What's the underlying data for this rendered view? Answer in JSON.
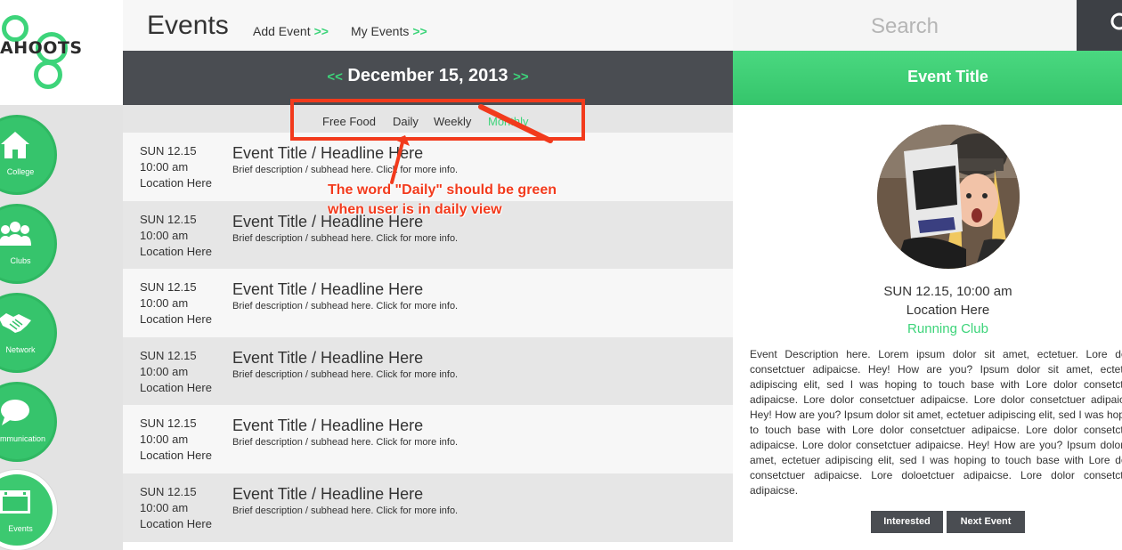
{
  "logo": {
    "text": "AHOOTS"
  },
  "nav": {
    "items": [
      {
        "label": "College",
        "icon": "house-icon"
      },
      {
        "label": "Clubs",
        "icon": "people-icon"
      },
      {
        "label": "Network",
        "icon": "handshake-icon"
      },
      {
        "label": "ommunication",
        "icon": "speech-bubble-icon"
      },
      {
        "label": "Events",
        "icon": "calendar-icon",
        "active": true
      }
    ]
  },
  "header": {
    "title": "Events",
    "links": [
      {
        "label": "Add Event",
        "arrows": ">>"
      },
      {
        "label": "My Events",
        "arrows": ">>"
      }
    ]
  },
  "date_bar": {
    "prev": "<<",
    "date": "December 15, 2013",
    "next": ">>"
  },
  "filters": {
    "items": [
      {
        "label": "Free Food",
        "active": false
      },
      {
        "label": "Daily",
        "active": false
      },
      {
        "label": "Weekly",
        "active": false
      },
      {
        "label": "Monthly",
        "active": true
      }
    ]
  },
  "events": [
    {
      "day": "SUN 12.15",
      "time": "10:00 am",
      "location": "Location Here",
      "title": "Event Title / Headline Here",
      "description": "Brief description / subhead here. Click for more info."
    },
    {
      "day": "SUN 12.15",
      "time": "10:00 am",
      "location": "Location Here",
      "title": "Event Title / Headline Here",
      "description": "Brief description / subhead here. Click for more info."
    },
    {
      "day": "SUN 12.15",
      "time": "10:00 am",
      "location": "Location Here",
      "title": "Event Title / Headline Here",
      "description": "Brief description / subhead here. Click for more info."
    },
    {
      "day": "SUN 12.15",
      "time": "10:00 am",
      "location": "Location Here",
      "title": "Event Title / Headline Here",
      "description": "Brief description / subhead here. Click for more info."
    },
    {
      "day": "SUN 12.15",
      "time": "10:00 am",
      "location": "Location Here",
      "title": "Event Title / Headline Here",
      "description": "Brief description / subhead here. Click for more info."
    },
    {
      "day": "SUN 12.15",
      "time": "10:00 am",
      "location": "Location Here",
      "title": "Event Title / Headline Here",
      "description": "Brief description / subhead here. Click for more info."
    }
  ],
  "annotation": {
    "line1": "The word \"Daily\" should be green",
    "line2": "when user is in daily view"
  },
  "search": {
    "placeholder": "Search"
  },
  "detail": {
    "header": "Event Title",
    "datetime": "SUN 12.15, 10:00 am",
    "location": "Location Here",
    "club": "Running Club",
    "description": "Event Description here. Lorem ipsum dolor sit amet, ectetuer. Lore dolor consetctuer adipaicse. Hey! How are you? Ipsum dolor sit amet, ectetuer adipiscing elit, sed I was hoping to touch base with Lore dolor consetctuer adipaicse. Lore dolor consetctuer adipaicse. Lore dolor consetctuer adipaicse. Hey! How are you? Ipsum dolor sit amet, ectetuer adipiscing elit, sed I was hoping to touch base with Lore dolor consetctuer adipaicse. Lore dolor consetctuer adipaicse. Lore dolor consetctuer adipaicse. Hey! How are you? Ipsum dolor sit amet, ectetuer adipiscing elit, sed I was hoping to touch base with Lore dolor consetctuer adipaicse. Lore doloetctuer adipaicse. Lore dolor consetctuer adipaicse.",
    "buttons": {
      "interested": "Interested",
      "next": "Next Event"
    }
  },
  "colors": {
    "accent": "#3dd47a",
    "dark_bar": "#4a4d52",
    "annotation": "#f23a1c"
  }
}
